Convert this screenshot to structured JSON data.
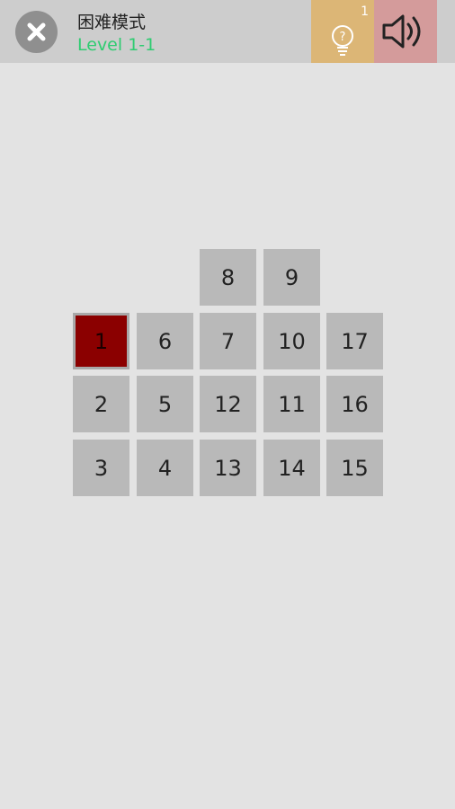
{
  "header": {
    "mode_title": "困难模式",
    "level_label": "Level 1-1",
    "hint_count": "1",
    "close_icon": "close-icon",
    "hint_icon": "lightbulb-question-icon",
    "sound_icon": "speaker-on-icon"
  },
  "colors": {
    "background": "#e3e3e3",
    "topbar": "#cdcdcd",
    "level_green": "#2ecc71",
    "hint_bg": "#dcb676",
    "sound_bg": "#d49b9b",
    "tile": "#b9b9b9",
    "selected_tile": "#8b0000"
  },
  "board": {
    "selected": "1",
    "tiles": [
      {
        "label": "8",
        "row": 0,
        "col": 2
      },
      {
        "label": "9",
        "row": 0,
        "col": 3
      },
      {
        "label": "1",
        "row": 1,
        "col": 0
      },
      {
        "label": "6",
        "row": 1,
        "col": 1
      },
      {
        "label": "7",
        "row": 1,
        "col": 2
      },
      {
        "label": "10",
        "row": 1,
        "col": 3
      },
      {
        "label": "17",
        "row": 1,
        "col": 4
      },
      {
        "label": "2",
        "row": 2,
        "col": 0
      },
      {
        "label": "5",
        "row": 2,
        "col": 1
      },
      {
        "label": "12",
        "row": 2,
        "col": 2
      },
      {
        "label": "11",
        "row": 2,
        "col": 3
      },
      {
        "label": "16",
        "row": 2,
        "col": 4
      },
      {
        "label": "3",
        "row": 3,
        "col": 0
      },
      {
        "label": "4",
        "row": 3,
        "col": 1
      },
      {
        "label": "13",
        "row": 3,
        "col": 2
      },
      {
        "label": "14",
        "row": 3,
        "col": 3
      },
      {
        "label": "15",
        "row": 3,
        "col": 4
      }
    ]
  }
}
